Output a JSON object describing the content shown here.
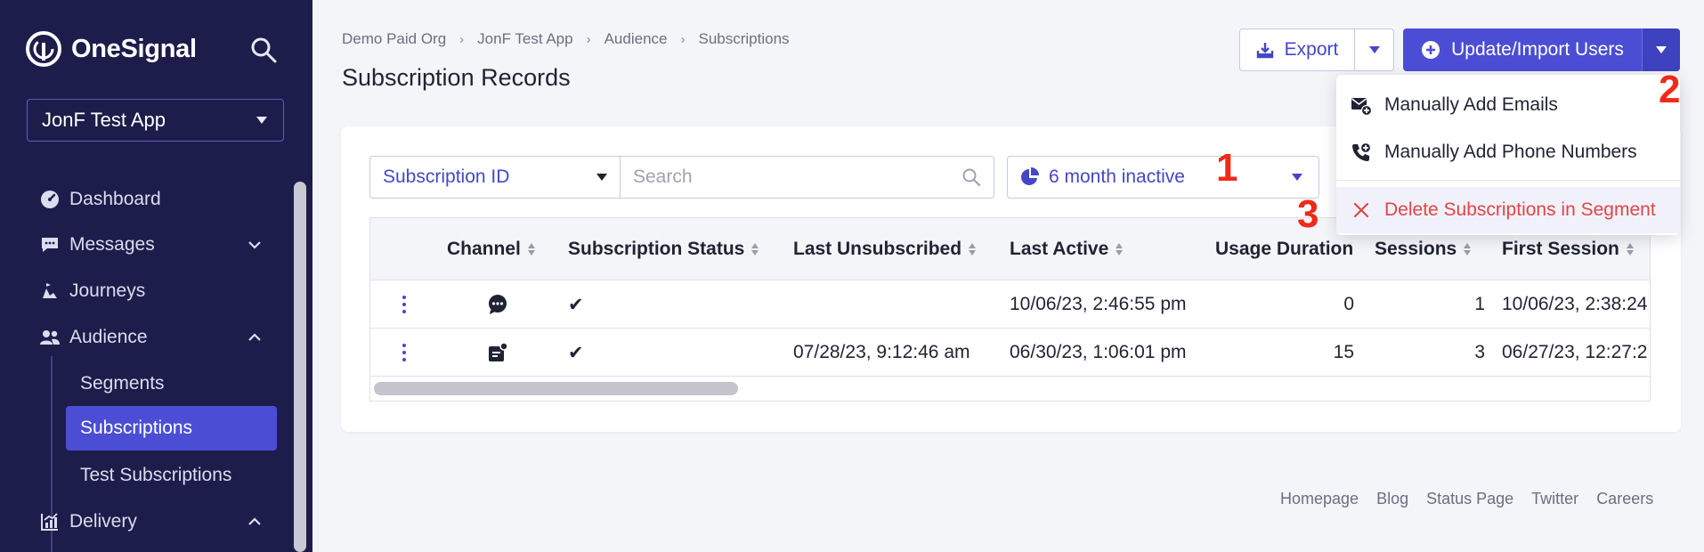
{
  "sidebar": {
    "brand": "OneSignal",
    "app_selector": "JonF Test App",
    "nav": [
      {
        "label": "Dashboard",
        "icon": "gauge-icon"
      },
      {
        "label": "Messages",
        "icon": "chat-icon"
      },
      {
        "label": "Journeys",
        "icon": "journey-icon"
      },
      {
        "label": "Audience",
        "icon": "users-icon"
      },
      {
        "label": "Delivery",
        "icon": "chart-icon"
      }
    ],
    "audience_sub": [
      "Segments",
      "Subscriptions",
      "Test Subscriptions"
    ]
  },
  "breadcrumb": [
    "Demo Paid Org",
    "JonF Test App",
    "Audience",
    "Subscriptions"
  ],
  "page_title": "Subscription Records",
  "toolbar": {
    "export_label": "Export",
    "update_label": "Update/Import Users"
  },
  "filters": {
    "field_select": "Subscription ID",
    "search_placeholder": "Search",
    "segment": "6 month inactive"
  },
  "table": {
    "columns": [
      "Channel",
      "Subscription Status",
      "Last Unsubscribed",
      "Last Active",
      "Usage Duration",
      "Sessions",
      "First Session"
    ],
    "rows": [
      {
        "channel_icon": "sms-icon",
        "status": "✔",
        "last_unsubscribed": "",
        "last_active": "10/06/23, 2:46:55 pm",
        "usage_duration": "0",
        "sessions": "1",
        "first_session": "10/06/23, 2:38:24"
      },
      {
        "channel_icon": "inbox-icon",
        "status": "✔",
        "last_unsubscribed": "07/28/23, 9:12:46 am",
        "last_active": "06/30/23, 1:06:01 pm",
        "usage_duration": "15",
        "sessions": "3",
        "first_session": "06/27/23, 12:27:2"
      }
    ]
  },
  "menu": {
    "items": [
      {
        "label": "Manually Add Emails",
        "icon": "email-add-icon"
      },
      {
        "label": "Manually Add Phone Numbers",
        "icon": "phone-add-icon"
      },
      {
        "label": "Delete Subscriptions in Segment",
        "icon": "close-icon"
      }
    ]
  },
  "annotations": [
    "1",
    "2",
    "3"
  ],
  "footer": [
    "Homepage",
    "Blog",
    "Status Page",
    "Twitter",
    "Careers"
  ],
  "colors": {
    "sidebar_bg": "#1d1d4b",
    "accent": "#4b4ed4",
    "danger": "#e04545",
    "annotation": "#f02a1a"
  }
}
